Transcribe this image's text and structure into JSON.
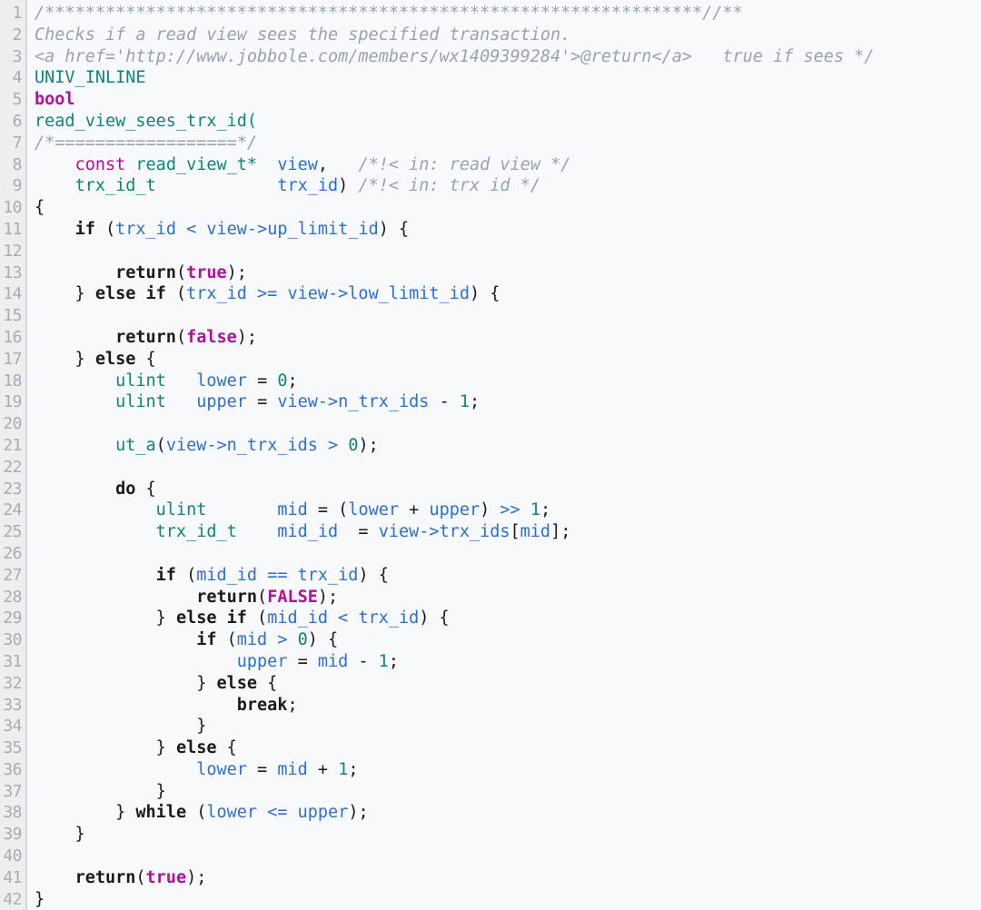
{
  "editor": {
    "language": "C",
    "theme": "light",
    "background_color": "#f7f9fc",
    "gutter_color": "#eceef0",
    "gutter_divider_color": "#d2d6da",
    "line_number_color": "#a8adb3",
    "first_line": 1,
    "last_line": 42,
    "total_lines": 42
  },
  "palette": {
    "comment": "#9aa2ad",
    "keyword": "#1a1a1a",
    "type": "#0f8577",
    "literal": "#b1109a",
    "modifier": "#b1109a",
    "identifier": "#2b6fd4",
    "function": "#0f8577",
    "number": "#0f8577",
    "operator": "#2b6fd4",
    "plain": "#1a1a1a"
  },
  "line_numbers": [
    1,
    2,
    3,
    4,
    5,
    6,
    7,
    8,
    9,
    10,
    11,
    12,
    13,
    14,
    15,
    16,
    17,
    18,
    19,
    20,
    21,
    22,
    23,
    24,
    25,
    26,
    27,
    28,
    29,
    30,
    31,
    32,
    33,
    34,
    35,
    36,
    37,
    38,
    39,
    40,
    41,
    42
  ],
  "code_lines": [
    {
      "n": 1,
      "text": "/*****************************************************************//**"
    },
    {
      "n": 2,
      "text": "Checks if a read view sees the specified transaction."
    },
    {
      "n": 3,
      "text": "<a href='http://www.jobbole.com/members/wx1409399284'>@return</a>   true if sees */"
    },
    {
      "n": 4,
      "text": "UNIV_INLINE"
    },
    {
      "n": 5,
      "text": "bool"
    },
    {
      "n": 6,
      "text": "read_view_sees_trx_id("
    },
    {
      "n": 7,
      "text": "/*==================*/"
    },
    {
      "n": 8,
      "text": "    const read_view_t*  view,   /*!< in: read view */"
    },
    {
      "n": 9,
      "text": "    trx_id_t            trx_id) /*!< in: trx id */"
    },
    {
      "n": 10,
      "text": "{"
    },
    {
      "n": 11,
      "text": "    if (trx_id < view->up_limit_id) {"
    },
    {
      "n": 12,
      "text": ""
    },
    {
      "n": 13,
      "text": "        return(true);"
    },
    {
      "n": 14,
      "text": "    } else if (trx_id >= view->low_limit_id) {"
    },
    {
      "n": 15,
      "text": ""
    },
    {
      "n": 16,
      "text": "        return(false);"
    },
    {
      "n": 17,
      "text": "    } else {"
    },
    {
      "n": 18,
      "text": "        ulint   lower = 0;"
    },
    {
      "n": 19,
      "text": "        ulint   upper = view->n_trx_ids - 1;"
    },
    {
      "n": 20,
      "text": ""
    },
    {
      "n": 21,
      "text": "        ut_a(view->n_trx_ids > 0);"
    },
    {
      "n": 22,
      "text": ""
    },
    {
      "n": 23,
      "text": "        do {"
    },
    {
      "n": 24,
      "text": "            ulint       mid = (lower + upper) >> 1;"
    },
    {
      "n": 25,
      "text": "            trx_id_t    mid_id  = view->trx_ids[mid];"
    },
    {
      "n": 26,
      "text": ""
    },
    {
      "n": 27,
      "text": "            if (mid_id == trx_id) {"
    },
    {
      "n": 28,
      "text": "                return(FALSE);"
    },
    {
      "n": 29,
      "text": "            } else if (mid_id < trx_id) {"
    },
    {
      "n": 30,
      "text": "                if (mid > 0) {"
    },
    {
      "n": 31,
      "text": "                    upper = mid - 1;"
    },
    {
      "n": 32,
      "text": "                } else {"
    },
    {
      "n": 33,
      "text": "                    break;"
    },
    {
      "n": 34,
      "text": "                }"
    },
    {
      "n": 35,
      "text": "            } else {"
    },
    {
      "n": 36,
      "text": "                lower = mid + 1;"
    },
    {
      "n": 37,
      "text": "            }"
    },
    {
      "n": 38,
      "text": "        } while (lower <= upper);"
    },
    {
      "n": 39,
      "text": "    }"
    },
    {
      "n": 40,
      "text": ""
    },
    {
      "n": 41,
      "text": "    return(true);"
    },
    {
      "n": 42,
      "text": "}"
    }
  ],
  "tokens": {
    "l1": [
      {
        "c": "cmt",
        "t": "/*****************************************************************//**"
      }
    ],
    "l2": [
      {
        "c": "cmt",
        "t": "Checks if a read view sees the specified transaction."
      }
    ],
    "l3": [
      {
        "c": "cmt",
        "t": "<a href='http://www.jobbole.com/members/wx1409399284'>@return</a>   true if sees */"
      }
    ],
    "l4": [
      {
        "c": "mac",
        "t": "UNIV_INLINE"
      }
    ],
    "l5": [
      {
        "c": "lit",
        "t": "bool"
      }
    ],
    "l6": [
      {
        "c": "fn",
        "t": "read_view_sees_trx_id("
      }
    ],
    "l7": [
      {
        "c": "cmt",
        "t": "/*==================*/"
      }
    ],
    "l8": [
      {
        "c": "pln",
        "t": "    "
      },
      {
        "c": "mod",
        "t": "const"
      },
      {
        "c": "pln",
        "t": " "
      },
      {
        "c": "typ",
        "t": "read_view_t*"
      },
      {
        "c": "pln",
        "t": "  "
      },
      {
        "c": "id",
        "t": "view"
      },
      {
        "c": "pln",
        "t": ",   "
      },
      {
        "c": "cmt",
        "t": "/*!< in: read view */"
      }
    ],
    "l9": [
      {
        "c": "pln",
        "t": "    "
      },
      {
        "c": "typ",
        "t": "trx_id_t"
      },
      {
        "c": "pln",
        "t": "            "
      },
      {
        "c": "id",
        "t": "trx_id"
      },
      {
        "c": "pln",
        "t": ") "
      },
      {
        "c": "cmt",
        "t": "/*!< in: trx id */"
      }
    ],
    "l10": [
      {
        "c": "punc",
        "t": "{"
      }
    ],
    "l11": [
      {
        "c": "pln",
        "t": "    "
      },
      {
        "c": "kw",
        "t": "if"
      },
      {
        "c": "pln",
        "t": " ("
      },
      {
        "c": "id",
        "t": "trx_id"
      },
      {
        "c": "pln",
        "t": " "
      },
      {
        "c": "op",
        "t": "<"
      },
      {
        "c": "pln",
        "t": " "
      },
      {
        "c": "id",
        "t": "view->up_limit_id"
      },
      {
        "c": "pln",
        "t": ") {"
      }
    ],
    "l12": [],
    "l13": [
      {
        "c": "pln",
        "t": "        "
      },
      {
        "c": "kw",
        "t": "return"
      },
      {
        "c": "pln",
        "t": "("
      },
      {
        "c": "lit",
        "t": "true"
      },
      {
        "c": "pln",
        "t": ");"
      }
    ],
    "l14": [
      {
        "c": "pln",
        "t": "    } "
      },
      {
        "c": "kw",
        "t": "else if"
      },
      {
        "c": "pln",
        "t": " ("
      },
      {
        "c": "id",
        "t": "trx_id"
      },
      {
        "c": "pln",
        "t": " "
      },
      {
        "c": "op",
        "t": ">="
      },
      {
        "c": "pln",
        "t": " "
      },
      {
        "c": "id",
        "t": "view->low_limit_id"
      },
      {
        "c": "pln",
        "t": ") {"
      }
    ],
    "l15": [],
    "l16": [
      {
        "c": "pln",
        "t": "        "
      },
      {
        "c": "kw",
        "t": "return"
      },
      {
        "c": "pln",
        "t": "("
      },
      {
        "c": "lit",
        "t": "false"
      },
      {
        "c": "pln",
        "t": ");"
      }
    ],
    "l17": [
      {
        "c": "pln",
        "t": "    } "
      },
      {
        "c": "kw",
        "t": "else"
      },
      {
        "c": "pln",
        "t": " {"
      }
    ],
    "l18": [
      {
        "c": "pln",
        "t": "        "
      },
      {
        "c": "typ",
        "t": "ulint"
      },
      {
        "c": "pln",
        "t": "   "
      },
      {
        "c": "id",
        "t": "lower"
      },
      {
        "c": "pln",
        "t": " = "
      },
      {
        "c": "num",
        "t": "0"
      },
      {
        "c": "pln",
        "t": ";"
      }
    ],
    "l19": [
      {
        "c": "pln",
        "t": "        "
      },
      {
        "c": "typ",
        "t": "ulint"
      },
      {
        "c": "pln",
        "t": "   "
      },
      {
        "c": "id",
        "t": "upper"
      },
      {
        "c": "pln",
        "t": " = "
      },
      {
        "c": "id",
        "t": "view->n_trx_ids"
      },
      {
        "c": "pln",
        "t": " - "
      },
      {
        "c": "num",
        "t": "1"
      },
      {
        "c": "pln",
        "t": ";"
      }
    ],
    "l20": [],
    "l21": [
      {
        "c": "pln",
        "t": "        "
      },
      {
        "c": "fn",
        "t": "ut_a"
      },
      {
        "c": "pln",
        "t": "("
      },
      {
        "c": "id",
        "t": "view->n_trx_ids"
      },
      {
        "c": "pln",
        "t": " "
      },
      {
        "c": "op",
        "t": ">"
      },
      {
        "c": "pln",
        "t": " "
      },
      {
        "c": "num",
        "t": "0"
      },
      {
        "c": "pln",
        "t": ");"
      }
    ],
    "l22": [],
    "l23": [
      {
        "c": "pln",
        "t": "        "
      },
      {
        "c": "kw",
        "t": "do"
      },
      {
        "c": "pln",
        "t": " {"
      }
    ],
    "l24": [
      {
        "c": "pln",
        "t": "            "
      },
      {
        "c": "typ",
        "t": "ulint"
      },
      {
        "c": "pln",
        "t": "       "
      },
      {
        "c": "id",
        "t": "mid"
      },
      {
        "c": "pln",
        "t": " = ("
      },
      {
        "c": "id",
        "t": "lower"
      },
      {
        "c": "pln",
        "t": " + "
      },
      {
        "c": "id",
        "t": "upper"
      },
      {
        "c": "pln",
        "t": ") "
      },
      {
        "c": "op",
        "t": ">>"
      },
      {
        "c": "pln",
        "t": " "
      },
      {
        "c": "num",
        "t": "1"
      },
      {
        "c": "pln",
        "t": ";"
      }
    ],
    "l25": [
      {
        "c": "pln",
        "t": "            "
      },
      {
        "c": "typ",
        "t": "trx_id_t"
      },
      {
        "c": "pln",
        "t": "    "
      },
      {
        "c": "id",
        "t": "mid_id"
      },
      {
        "c": "pln",
        "t": "  = "
      },
      {
        "c": "id",
        "t": "view->trx_ids"
      },
      {
        "c": "pln",
        "t": "["
      },
      {
        "c": "id",
        "t": "mid"
      },
      {
        "c": "pln",
        "t": "];"
      }
    ],
    "l26": [],
    "l27": [
      {
        "c": "pln",
        "t": "            "
      },
      {
        "c": "kw",
        "t": "if"
      },
      {
        "c": "pln",
        "t": " ("
      },
      {
        "c": "id",
        "t": "mid_id"
      },
      {
        "c": "pln",
        "t": " "
      },
      {
        "c": "op",
        "t": "=="
      },
      {
        "c": "pln",
        "t": " "
      },
      {
        "c": "id",
        "t": "trx_id"
      },
      {
        "c": "pln",
        "t": ") {"
      }
    ],
    "l28": [
      {
        "c": "pln",
        "t": "                "
      },
      {
        "c": "kw",
        "t": "return"
      },
      {
        "c": "pln",
        "t": "("
      },
      {
        "c": "lit",
        "t": "FALSE"
      },
      {
        "c": "pln",
        "t": ");"
      }
    ],
    "l29": [
      {
        "c": "pln",
        "t": "            } "
      },
      {
        "c": "kw",
        "t": "else if"
      },
      {
        "c": "pln",
        "t": " ("
      },
      {
        "c": "id",
        "t": "mid_id"
      },
      {
        "c": "pln",
        "t": " "
      },
      {
        "c": "op",
        "t": "<"
      },
      {
        "c": "pln",
        "t": " "
      },
      {
        "c": "id",
        "t": "trx_id"
      },
      {
        "c": "pln",
        "t": ") {"
      }
    ],
    "l30": [
      {
        "c": "pln",
        "t": "                "
      },
      {
        "c": "kw",
        "t": "if"
      },
      {
        "c": "pln",
        "t": " ("
      },
      {
        "c": "id",
        "t": "mid"
      },
      {
        "c": "pln",
        "t": " "
      },
      {
        "c": "op",
        "t": ">"
      },
      {
        "c": "pln",
        "t": " "
      },
      {
        "c": "num",
        "t": "0"
      },
      {
        "c": "pln",
        "t": ") {"
      }
    ],
    "l31": [
      {
        "c": "pln",
        "t": "                    "
      },
      {
        "c": "id",
        "t": "upper"
      },
      {
        "c": "pln",
        "t": " = "
      },
      {
        "c": "id",
        "t": "mid"
      },
      {
        "c": "pln",
        "t": " - "
      },
      {
        "c": "num",
        "t": "1"
      },
      {
        "c": "pln",
        "t": ";"
      }
    ],
    "l32": [
      {
        "c": "pln",
        "t": "                } "
      },
      {
        "c": "kw",
        "t": "else"
      },
      {
        "c": "pln",
        "t": " {"
      }
    ],
    "l33": [
      {
        "c": "pln",
        "t": "                    "
      },
      {
        "c": "kw",
        "t": "break"
      },
      {
        "c": "pln",
        "t": ";"
      }
    ],
    "l34": [
      {
        "c": "pln",
        "t": "                }"
      }
    ],
    "l35": [
      {
        "c": "pln",
        "t": "            } "
      },
      {
        "c": "kw",
        "t": "else"
      },
      {
        "c": "pln",
        "t": " {"
      }
    ],
    "l36": [
      {
        "c": "pln",
        "t": "                "
      },
      {
        "c": "id",
        "t": "lower"
      },
      {
        "c": "pln",
        "t": " = "
      },
      {
        "c": "id",
        "t": "mid"
      },
      {
        "c": "pln",
        "t": " + "
      },
      {
        "c": "num",
        "t": "1"
      },
      {
        "c": "pln",
        "t": ";"
      }
    ],
    "l37": [
      {
        "c": "pln",
        "t": "            }"
      }
    ],
    "l38": [
      {
        "c": "pln",
        "t": "        } "
      },
      {
        "c": "kw",
        "t": "while"
      },
      {
        "c": "pln",
        "t": " ("
      },
      {
        "c": "id",
        "t": "lower"
      },
      {
        "c": "pln",
        "t": " "
      },
      {
        "c": "op",
        "t": "<="
      },
      {
        "c": "pln",
        "t": " "
      },
      {
        "c": "id",
        "t": "upper"
      },
      {
        "c": "pln",
        "t": ");"
      }
    ],
    "l39": [
      {
        "c": "pln",
        "t": "    }"
      }
    ],
    "l40": [],
    "l41": [
      {
        "c": "pln",
        "t": "    "
      },
      {
        "c": "kw",
        "t": "return"
      },
      {
        "c": "pln",
        "t": "("
      },
      {
        "c": "lit",
        "t": "true"
      },
      {
        "c": "pln",
        "t": ");"
      }
    ],
    "l42": [
      {
        "c": "punc",
        "t": "}"
      }
    ]
  }
}
